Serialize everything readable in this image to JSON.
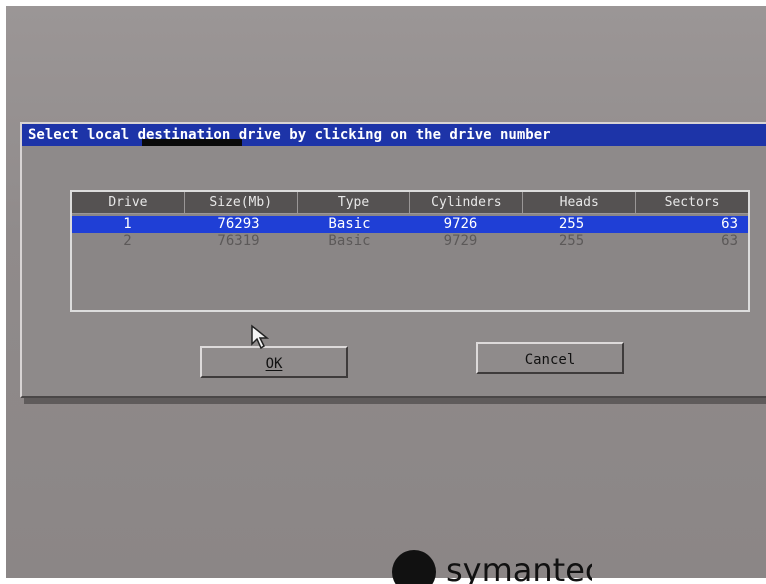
{
  "dialog": {
    "title": "Select local destination drive by clicking on the drive number"
  },
  "table": {
    "columns": [
      "Drive",
      "Size(Mb)",
      "Type",
      "Cylinders",
      "Heads",
      "Sectors"
    ],
    "rows": [
      {
        "drive": "1",
        "size": "76293",
        "type": "Basic",
        "cylinders": "9726",
        "heads": "255",
        "sectors": "63",
        "selected": true
      },
      {
        "drive": "2",
        "size": "76319",
        "type": "Basic",
        "cylinders": "9729",
        "heads": "255",
        "sectors": "63",
        "selected": false
      }
    ]
  },
  "buttons": {
    "ok": "OK",
    "cancel": "Cancel"
  },
  "branding": {
    "logo_text": "symantec."
  },
  "colors": {
    "title_bar": "#1d34a8",
    "selection": "#1f3fd6",
    "background": "#908b8b"
  }
}
